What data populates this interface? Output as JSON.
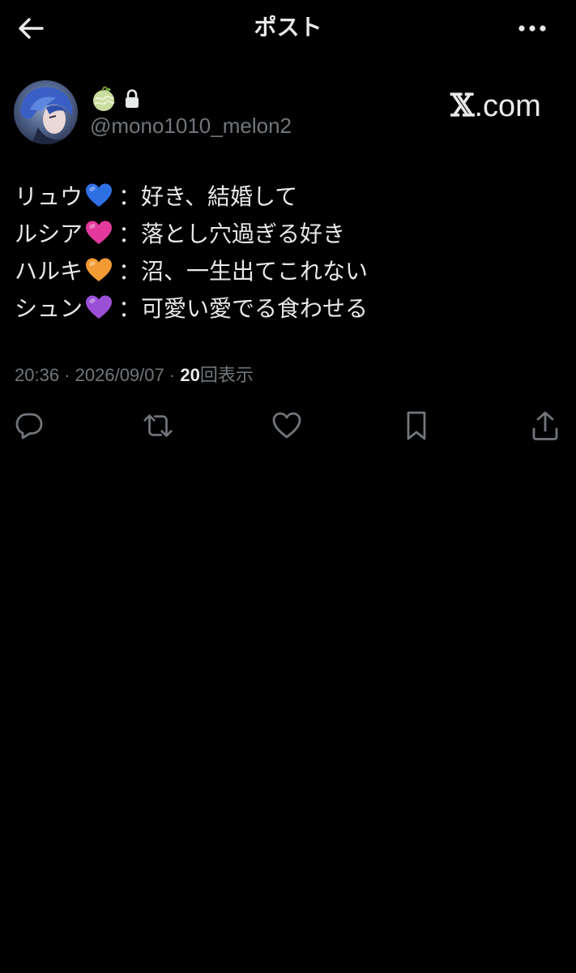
{
  "header": {
    "title": "ポスト"
  },
  "profile": {
    "username": "@mono1010_melon2"
  },
  "watermark": {
    "text": ".com"
  },
  "tweet": {
    "lines": [
      {
        "name": "リュウ",
        "heart_color": "#2f6fe4",
        "text": "：好き、結婚して"
      },
      {
        "name": "ルシア",
        "heart_color": "#e4399c",
        "text": "：落とし穴過ぎる好き"
      },
      {
        "name": "ハルキ",
        "heart_color": "#f29a33",
        "text": "：沼、一生出てこれない"
      },
      {
        "name": "シュン",
        "heart_color": "#9b4fd6",
        "text": "：可愛い愛でる食わせる"
      }
    ]
  },
  "meta": {
    "time": "20:36",
    "date": "2026/09/07",
    "separator": "·",
    "views_count": "20",
    "views_label": "回表示"
  },
  "colors": {
    "background": "#000000",
    "text": "#e7e9ea",
    "muted": "#71767b"
  },
  "icons": {
    "back": "arrow-left-icon",
    "more": "more-horizontal-icon",
    "reply": "reply-icon",
    "repost": "repost-icon",
    "like": "heart-outline-icon",
    "bookmark": "bookmark-icon",
    "share": "share-icon"
  }
}
